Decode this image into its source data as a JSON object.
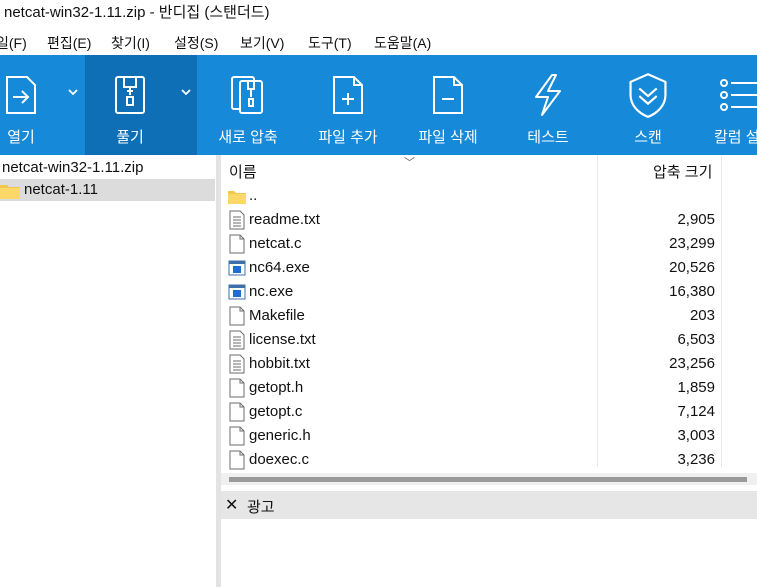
{
  "window": {
    "title": "netcat-win32-1.11.zip - 반디집 (스탠더드)"
  },
  "menu": {
    "items": [
      "일(F)",
      "편집(E)",
      "찾기(I)",
      "설정(S)",
      "보기(V)",
      "도구(T)",
      "도움말(A)"
    ]
  },
  "toolbar": {
    "open_label": "열기",
    "extract_label": "풀기",
    "new_archive_label": "새로 압축",
    "add_file_label": "파일 추가",
    "delete_file_label": "파일 삭제",
    "test_label": "테스트",
    "scan_label": "스캔",
    "columns_label": "칼럼 설"
  },
  "tree": {
    "root": "netcat-win32-1.11.zip",
    "selected_folder": "netcat-1.11"
  },
  "list": {
    "col_name": "이름",
    "col_size": "압축 크기",
    "rows": [
      {
        "name": "..",
        "size": "",
        "icon": "folder-icon"
      },
      {
        "name": "readme.txt",
        "size": "2,905",
        "icon": "text-file-icon"
      },
      {
        "name": "netcat.c",
        "size": "23,299",
        "icon": "file-icon"
      },
      {
        "name": "nc64.exe",
        "size": "20,526",
        "icon": "exe-file-icon"
      },
      {
        "name": "nc.exe",
        "size": "16,380",
        "icon": "exe-file-icon"
      },
      {
        "name": "Makefile",
        "size": "203",
        "icon": "file-icon"
      },
      {
        "name": "license.txt",
        "size": "6,503",
        "icon": "text-file-icon"
      },
      {
        "name": "hobbit.txt",
        "size": "23,256",
        "icon": "text-file-icon"
      },
      {
        "name": "getopt.h",
        "size": "1,859",
        "icon": "file-icon"
      },
      {
        "name": "getopt.c",
        "size": "7,124",
        "icon": "file-icon"
      },
      {
        "name": "generic.h",
        "size": "3,003",
        "icon": "file-icon"
      },
      {
        "name": "doexec.c",
        "size": "3,236",
        "icon": "file-icon"
      }
    ]
  },
  "ad": {
    "label": "광고"
  },
  "colors": {
    "toolbar": "#1689d8",
    "toolbar_active": "#0f6fb6",
    "selection": "#dcdcdc"
  }
}
